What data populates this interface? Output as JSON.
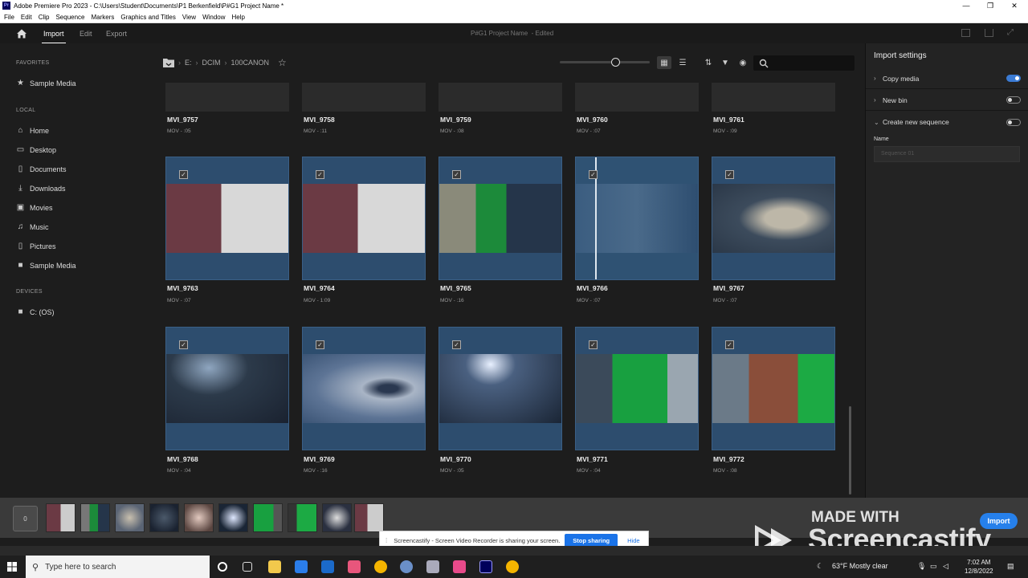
{
  "window": {
    "title": "Adobe Premiere Pro 2023 - C:\\Users\\Student\\Documents\\P1 Berkenfield\\P#G1 Project Name *"
  },
  "menu": [
    "File",
    "Edit",
    "Clip",
    "Sequence",
    "Markers",
    "Graphics and Titles",
    "View",
    "Window",
    "Help"
  ],
  "header": {
    "tabs": [
      "Import",
      "Edit",
      "Export"
    ],
    "project_name": "P#G1 Project Name",
    "status": "- Edited"
  },
  "sidebar": {
    "favorites_label": "FAVORITES",
    "favorites": [
      "Sample Media"
    ],
    "local_label": "LOCAL",
    "local": [
      "Home",
      "Desktop",
      "Documents",
      "Downloads",
      "Movies",
      "Music",
      "Pictures",
      "Sample Media"
    ],
    "devices_label": "DEVICES",
    "devices": [
      "C: (OS)"
    ]
  },
  "breadcrumb": [
    "E:",
    "DCIM",
    "100CANON"
  ],
  "clips": [
    {
      "name": "MVI_9757",
      "meta": "MOV - :05"
    },
    {
      "name": "MVI_9758",
      "meta": "MOV - :11"
    },
    {
      "name": "MVI_9759",
      "meta": "MOV - :08"
    },
    {
      "name": "MVI_9760",
      "meta": "MOV - :07"
    },
    {
      "name": "MVI_9761",
      "meta": "MOV - :09"
    },
    {
      "name": "MVI_9763",
      "meta": "MOV - :07"
    },
    {
      "name": "MVI_9764",
      "meta": "MOV - 1:09"
    },
    {
      "name": "MVI_9765",
      "meta": "MOV - :16"
    },
    {
      "name": "MVI_9766",
      "meta": "MOV - :07"
    },
    {
      "name": "MVI_9767",
      "meta": "MOV - :07"
    },
    {
      "name": "MVI_9768",
      "meta": "MOV - :04"
    },
    {
      "name": "MVI_9769",
      "meta": "MOV - :16"
    },
    {
      "name": "MVI_9770",
      "meta": "MOV - :05"
    },
    {
      "name": "MVI_9771",
      "meta": "MOV - :04"
    },
    {
      "name": "MVI_9772",
      "meta": "MOV - :08"
    }
  ],
  "import_settings": {
    "title": "Import settings",
    "copy_media": "Copy media",
    "new_bin": "New bin",
    "create_sequence": "Create new sequence",
    "name_label": "Name",
    "name_placeholder": "Sequence 01"
  },
  "tray": {
    "count": "0",
    "import_button": "Import"
  },
  "watermark": {
    "made_with": "MADE WITH",
    "brand": "Screencastify"
  },
  "share_bar": {
    "message": "Screencastify - Screen Video Recorder is sharing your screen.",
    "stop": "Stop sharing",
    "hide": "Hide"
  },
  "taskbar": {
    "search_placeholder": "Type here to search",
    "weather": "63°F  Mostly clear",
    "time": "7:02 AM",
    "date": "12/8/2022"
  },
  "colors": {
    "accent": "#2680eb",
    "selected_card": "#2d4d6e"
  }
}
